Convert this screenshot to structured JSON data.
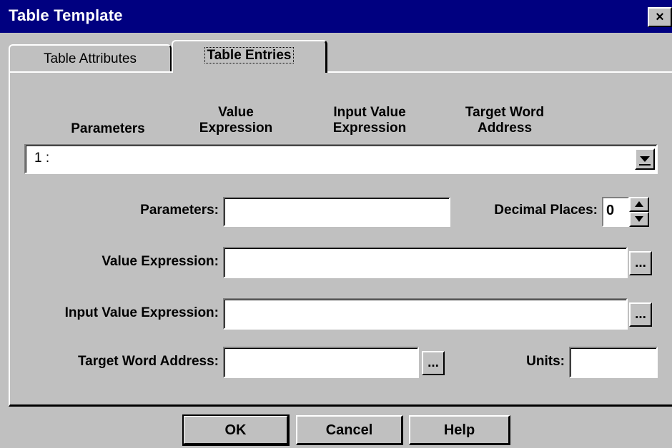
{
  "window": {
    "title": "Table Template",
    "close_label": "×"
  },
  "tabs": [
    {
      "label": "Table Attributes",
      "active": false
    },
    {
      "label": "Table Entries",
      "active": true
    }
  ],
  "columns": [
    "Parameters",
    "Value\nExpression",
    "Input Value\nExpression",
    "Target Word\nAddress"
  ],
  "entry_list": {
    "selected": "1 :"
  },
  "form": {
    "parameters_label": "Parameters:",
    "parameters_value": "",
    "decimal_places_label": "Decimal Places:",
    "decimal_places_value": "0",
    "value_expression_label": "Value Expression:",
    "value_expression_value": "",
    "input_value_expression_label": "Input Value Expression:",
    "input_value_expression_value": "",
    "target_word_address_label": "Target Word Address:",
    "target_word_address_value": "",
    "units_label": "Units:",
    "units_value": "",
    "browse_label": "..."
  },
  "buttons": {
    "ok": "OK",
    "cancel": "Cancel",
    "help": "Help"
  },
  "colors": {
    "titlebar": "#000080",
    "face": "#c0c0c0"
  }
}
